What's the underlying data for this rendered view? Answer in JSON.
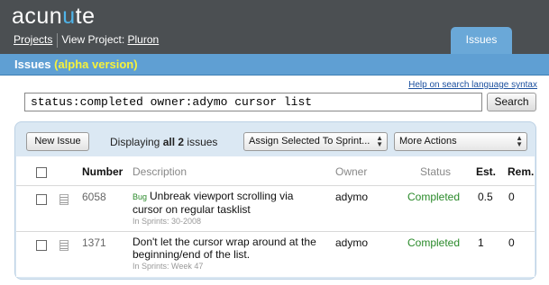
{
  "header": {
    "logo_pre": "acun",
    "logo_accent": "u",
    "logo_post": "te",
    "nav_projects": "Projects",
    "nav_view_project": "View Project:",
    "nav_project_name": "Pluron",
    "tab_issues": "Issues"
  },
  "titlebar": {
    "title": "Issues",
    "alpha": "(alpha version)"
  },
  "search": {
    "help_link": "Help on search language syntax",
    "query": "status:completed owner:adymo cursor list",
    "button": "Search"
  },
  "toolbar": {
    "new_issue": "New Issue",
    "displaying_pre": "Displaying",
    "displaying_bold": "all 2",
    "displaying_post": "issues",
    "assign_select": "Assign Selected To Sprint...",
    "more_select": "More Actions"
  },
  "table": {
    "columns": {
      "number": "Number",
      "description": "Description",
      "owner": "Owner",
      "status": "Status",
      "est": "Est.",
      "rem": "Rem."
    },
    "rows": [
      {
        "number": "6058",
        "tag": "Bug",
        "description": "Unbreak viewport scrolling via cursor on regular tasklist",
        "sprints": "In Sprints: 30-2008",
        "owner": "adymo",
        "status": "Completed",
        "est": "0.5",
        "rem": "0"
      },
      {
        "number": "1371",
        "tag": "",
        "description": "Don't let the cursor wrap around at the beginning/end of the list.",
        "sprints": "In Sprints: Week 47",
        "owner": "adymo",
        "status": "Completed",
        "est": "1",
        "rem": "0"
      }
    ]
  },
  "colors": {
    "header_bg": "#4b4f52",
    "titlebar_bg": "#5f9fd3",
    "alpha_text": "#f7f23a",
    "status_completed": "#2a8a2a",
    "panel_bg": "#dbe8f3"
  }
}
